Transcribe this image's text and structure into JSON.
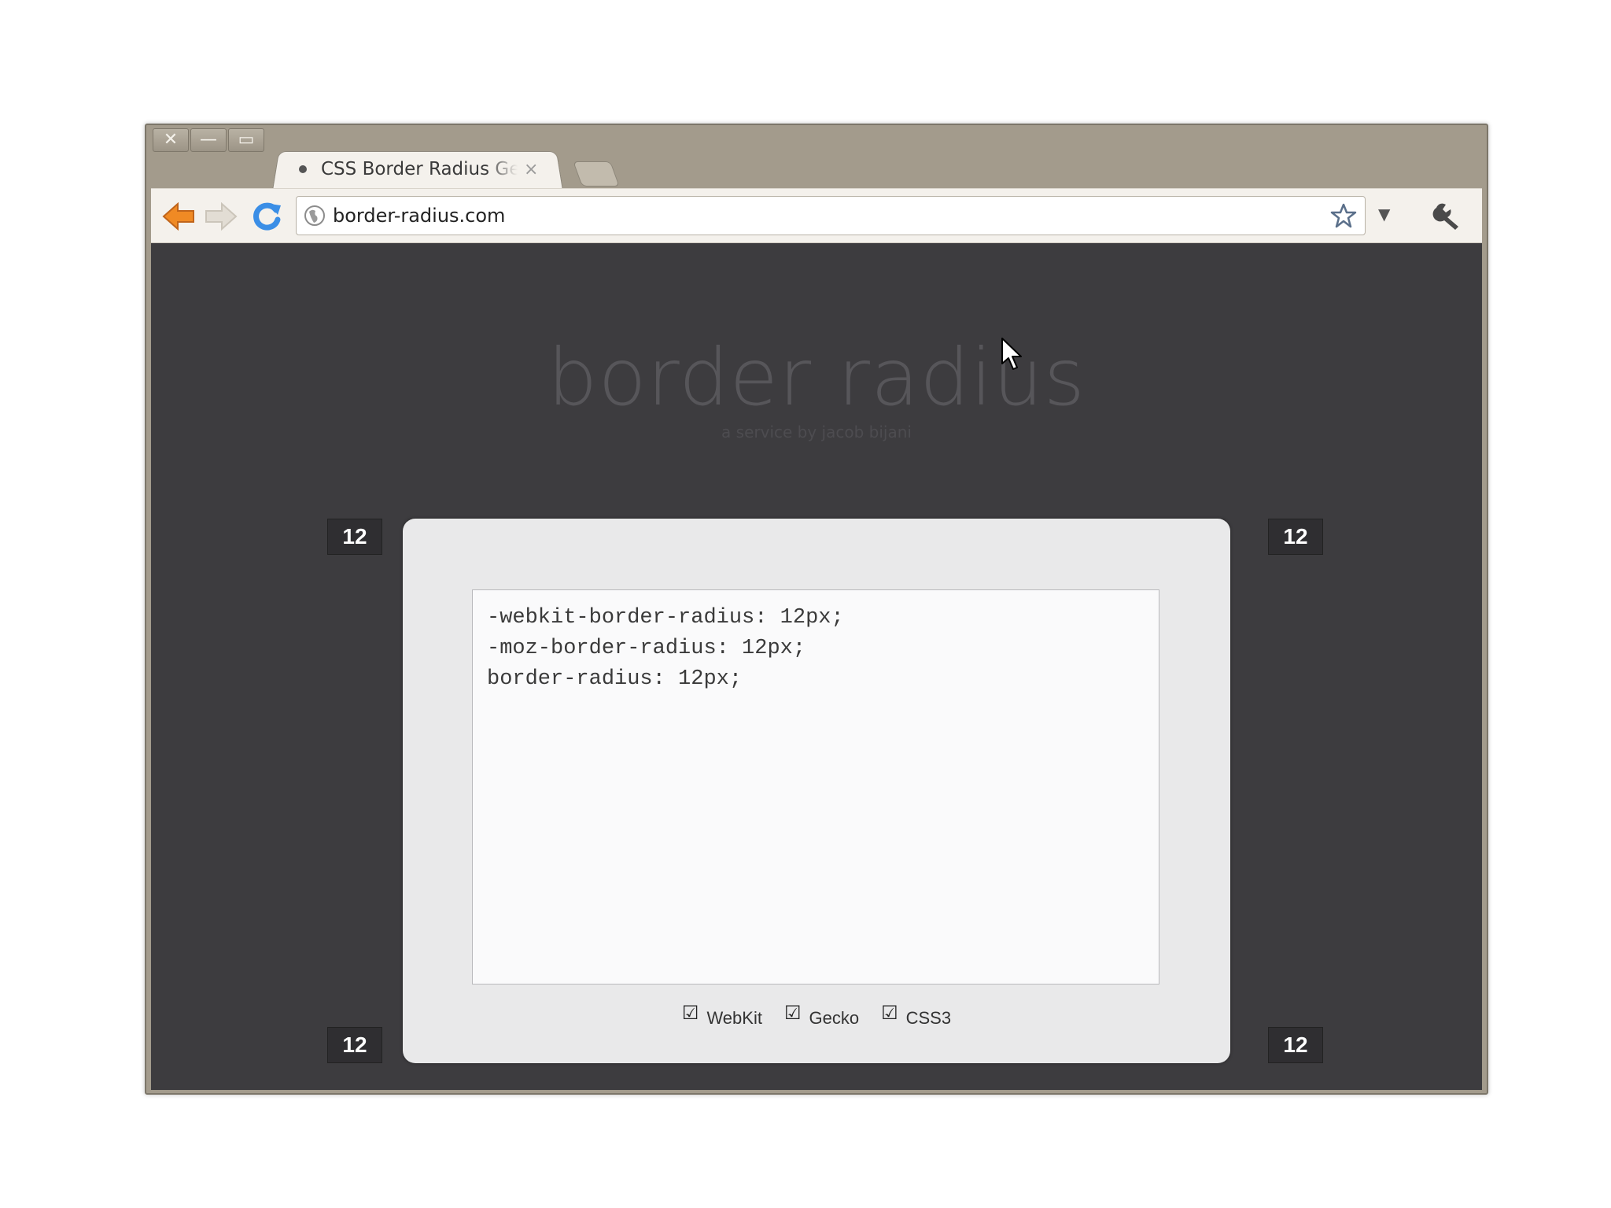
{
  "window_controls": {
    "close": "✕",
    "minimize": "—",
    "maximize": "▭"
  },
  "tab": {
    "title": "CSS Border Radius Generator",
    "close": "×"
  },
  "address_bar": {
    "url": "border-radius.com"
  },
  "page": {
    "title": "border radius",
    "subtitle": "a service by jacob bijani",
    "radius": {
      "top_left": "12",
      "top_right": "12",
      "bottom_left": "12",
      "bottom_right": "12"
    },
    "code": "-webkit-border-radius: 12px;\n-moz-border-radius: 12px;\nborder-radius: 12px;",
    "options": [
      {
        "label": "WebKit",
        "checked": true
      },
      {
        "label": "Gecko",
        "checked": true
      },
      {
        "label": "CSS3",
        "checked": true
      }
    ]
  },
  "icons": {
    "back": "back-arrow-icon",
    "forward": "forward-arrow-icon",
    "reload": "reload-icon",
    "bookmark": "star-icon",
    "menu": "wrench-icon"
  },
  "colors": {
    "page_bg": "#3d3c3f",
    "chrome_bg": "#a39b8c",
    "accent_orange": "#f08a24",
    "accent_blue": "#3a8ee6"
  }
}
